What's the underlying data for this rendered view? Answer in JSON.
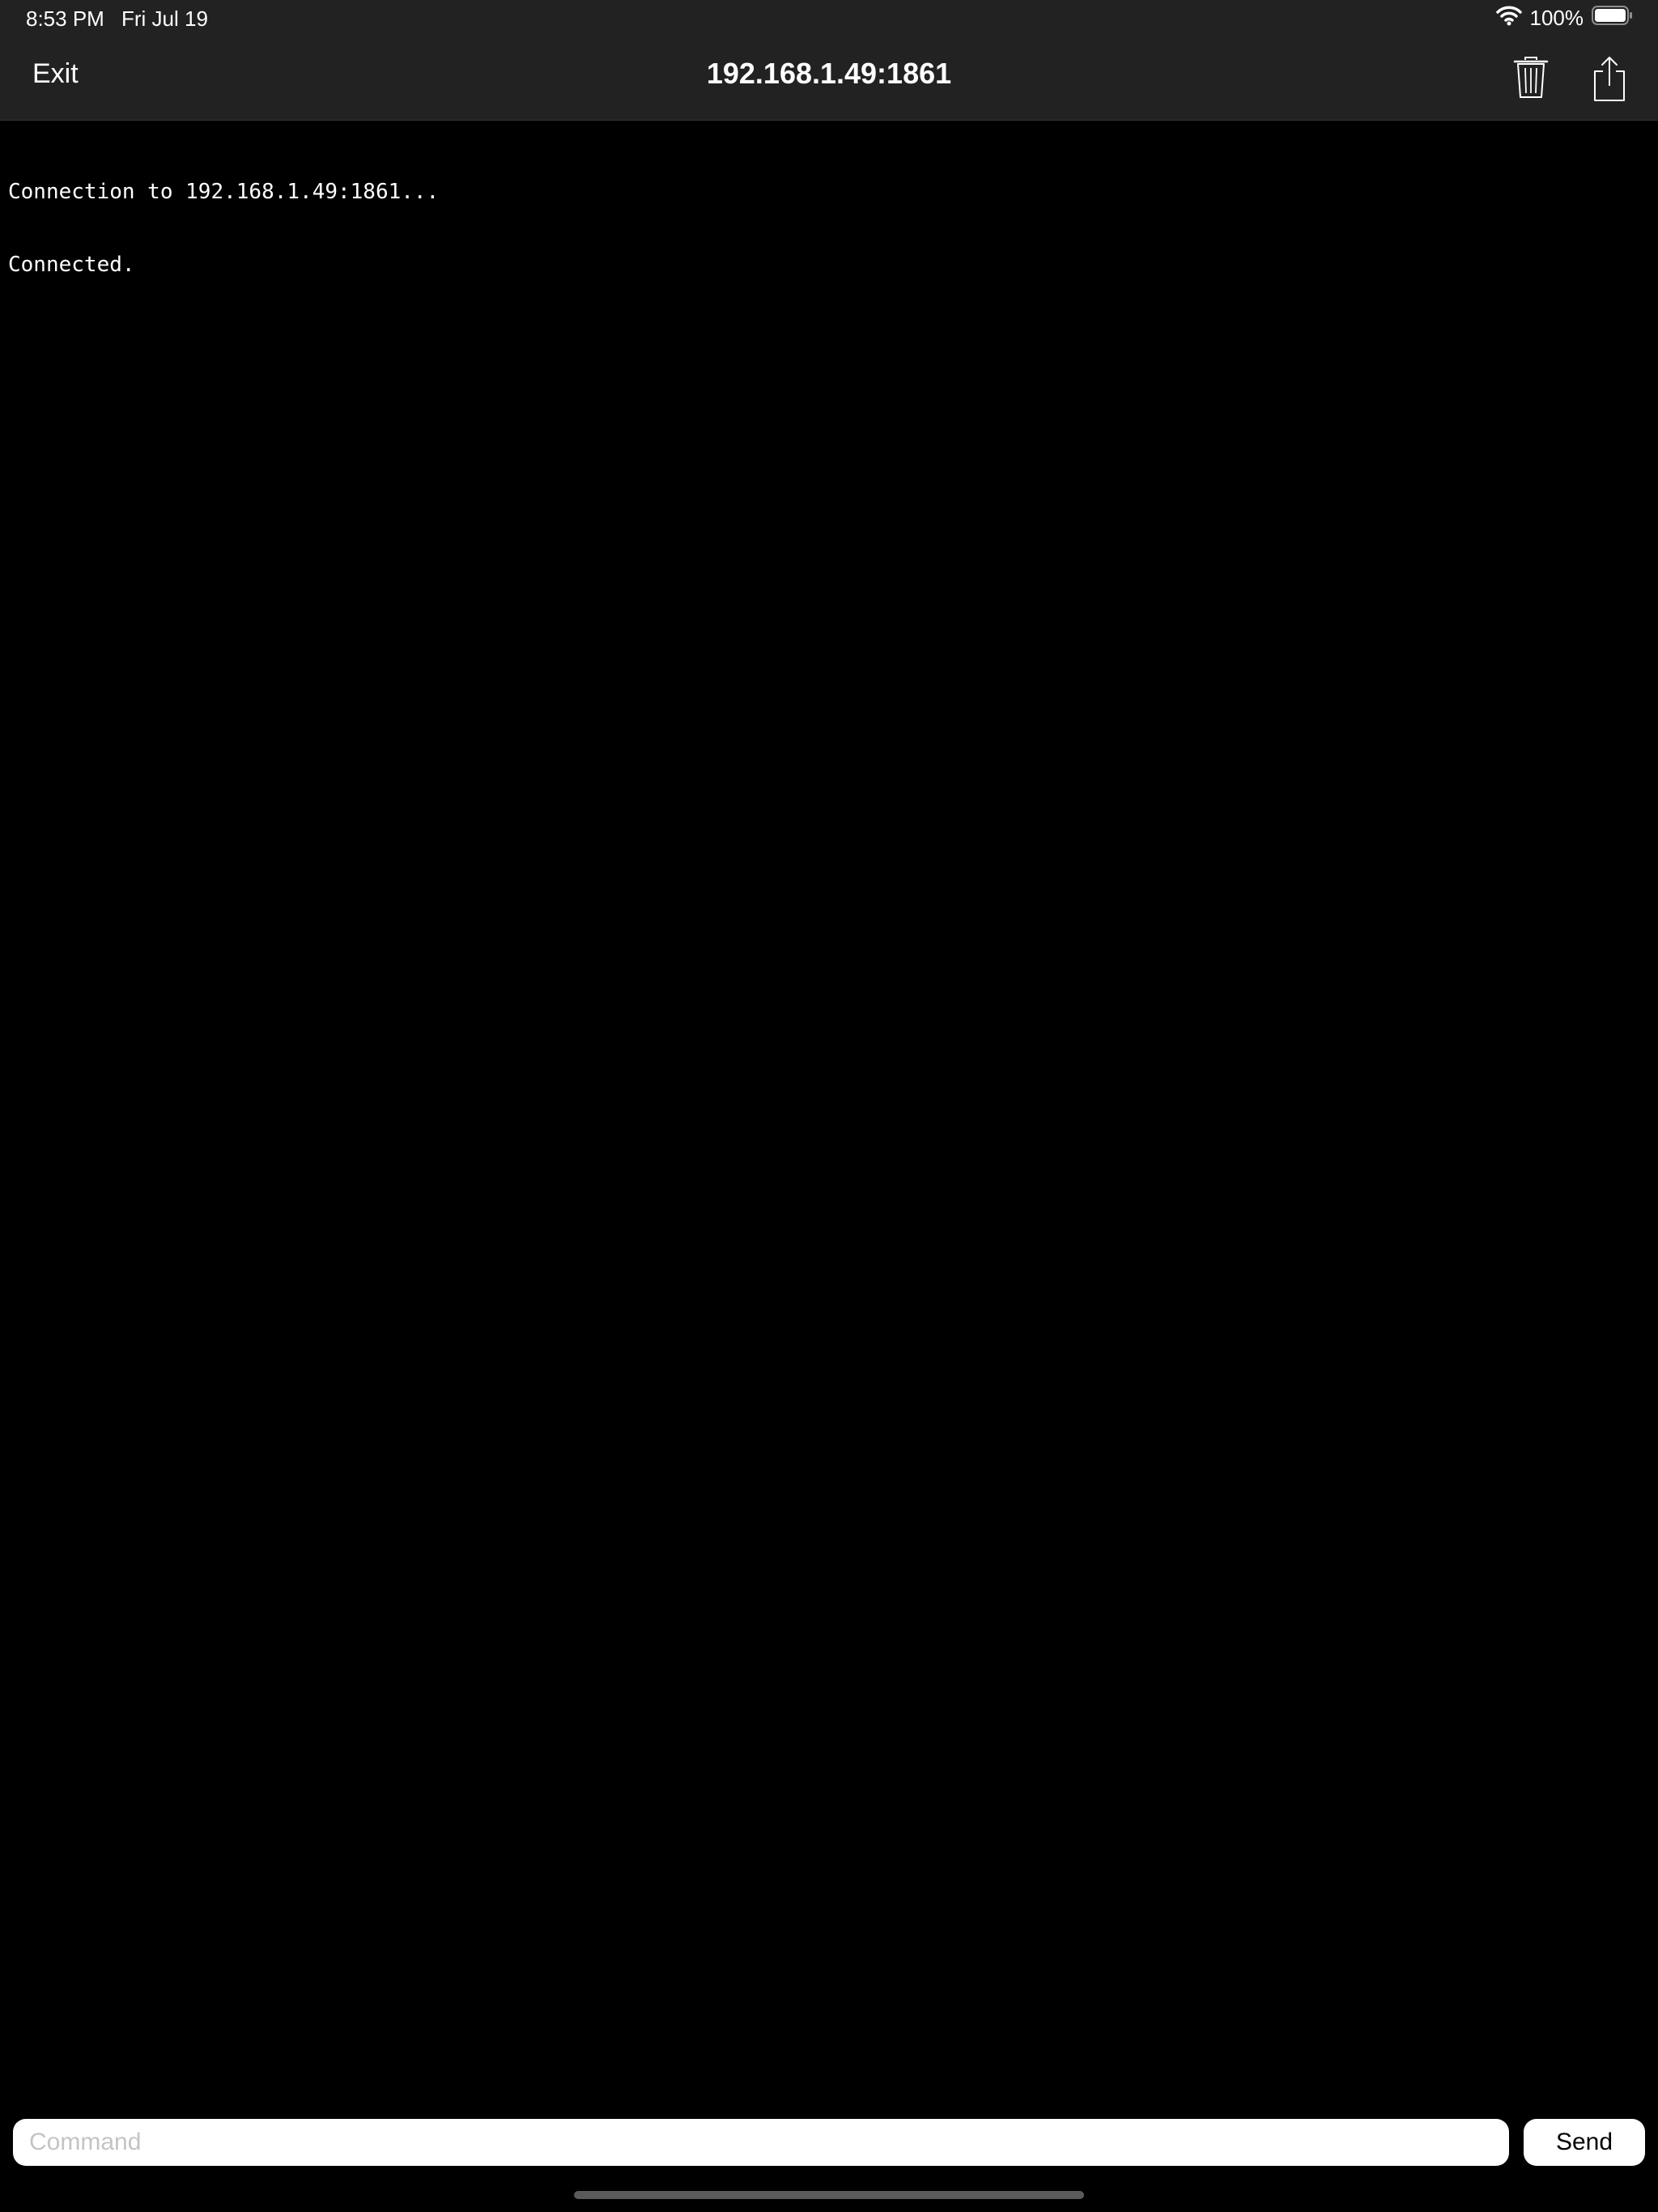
{
  "status_bar": {
    "time": "8:53 PM",
    "date": "Fri Jul 19",
    "battery_percent": "100%",
    "battery_level": 1.0,
    "icons": [
      "wifi-icon",
      "battery-icon"
    ]
  },
  "nav": {
    "exit_label": "Exit",
    "title": "192.168.1.49:1861",
    "icons": [
      "trash-icon",
      "share-icon"
    ]
  },
  "terminal": {
    "lines": [
      "Connection to 192.168.1.49:1861...",
      "Connected."
    ]
  },
  "input": {
    "placeholder": "Command",
    "value": ""
  },
  "send_label": "Send",
  "colors": {
    "bar_background": "#222222",
    "terminal_background": "#000000",
    "text": "#ffffff"
  }
}
